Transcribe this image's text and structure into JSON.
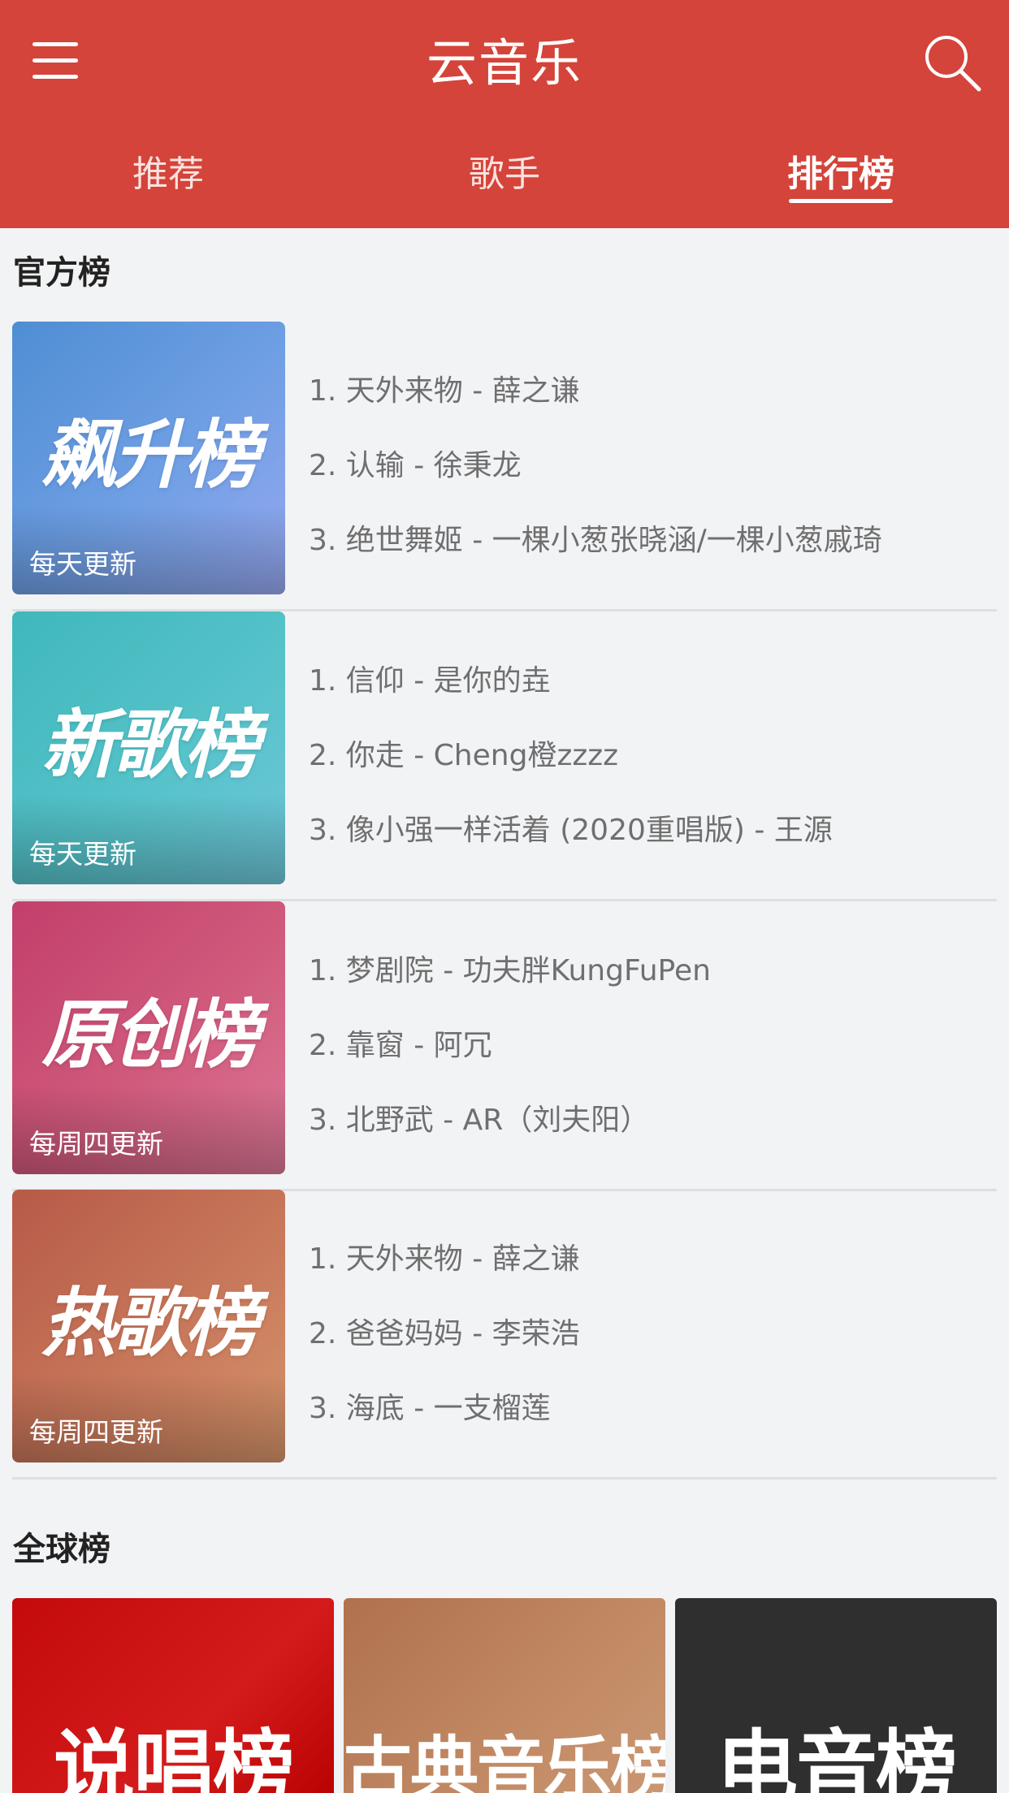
{
  "header": {
    "title": "云音乐",
    "tabs": [
      {
        "label": "推荐",
        "active": false
      },
      {
        "label": "歌手",
        "active": false
      },
      {
        "label": "排行榜",
        "active": true
      }
    ]
  },
  "colors": {
    "header_bg": "#d4443a",
    "page_bg": "#f2f3f5",
    "song_text": "#6f6f6f"
  },
  "official": {
    "title": "官方榜",
    "charts": [
      {
        "name": "飙升榜",
        "update": "每天更新",
        "songs": [
          "1. 天外来物 - 薛之谦",
          "2. 认输 - 徐秉龙",
          "3. 绝世舞姬 - 一棵小葱张晓涵/一棵小葱戚琦"
        ]
      },
      {
        "name": "新歌榜",
        "update": "每天更新",
        "songs": [
          "1. 信仰 - 是你的垚",
          "2. 你走 - Cheng橙zzzz",
          "3. 像小强一样活着 (2020重唱版) - 王源"
        ]
      },
      {
        "name": "原创榜",
        "update": "每周四更新",
        "songs": [
          "1. 梦剧院 - 功夫胖KungFuPen",
          "2. 靠窗 - 阿冗",
          "3. 北野武 - AR（刘夫阳）"
        ]
      },
      {
        "name": "热歌榜",
        "update": "每周四更新",
        "songs": [
          "1. 天外来物 - 薛之谦",
          "2. 爸爸妈妈 - 李荣浩",
          "3. 海底 - 一支榴莲"
        ]
      }
    ]
  },
  "global": {
    "title": "全球榜",
    "charts": [
      {
        "name": "说唱榜"
      },
      {
        "name": "古典音乐榜"
      },
      {
        "name": "电音榜"
      }
    ]
  }
}
